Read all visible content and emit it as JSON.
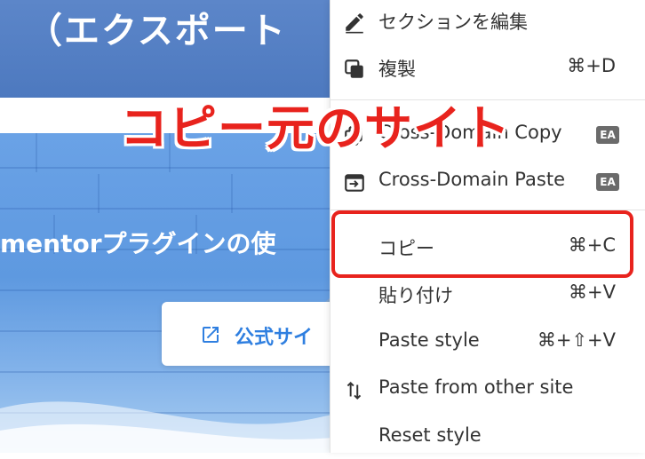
{
  "background_page": {
    "header_title": "（エクスポート",
    "hero_heading": "mentorプラグインの使",
    "official_button_label": "公式サイ"
  },
  "annotation": "コピー元のサイト",
  "context_menu": {
    "items": [
      {
        "label": "セクションを編集",
        "shortcut": "",
        "icon": "pencil-icon",
        "badge": ""
      },
      {
        "label": "複製",
        "shortcut": "⌘+D",
        "icon": "duplicate-icon",
        "badge": ""
      },
      {
        "label": "Cross-Domain Copy",
        "shortcut": "",
        "icon": "copy-icon",
        "badge": "EA"
      },
      {
        "label": "Cross-Domain Paste",
        "shortcut": "",
        "icon": "paste-window-icon",
        "badge": "EA"
      },
      {
        "label": "コピー",
        "shortcut": "⌘+C",
        "icon": "",
        "badge": ""
      },
      {
        "label": "貼り付け",
        "shortcut": "⌘+V",
        "icon": "",
        "badge": ""
      },
      {
        "label": "Paste style",
        "shortcut": "⌘+⇧+V",
        "icon": "",
        "badge": ""
      },
      {
        "label": "Paste from other site",
        "shortcut": "",
        "icon": "swap-arrows-icon",
        "badge": ""
      },
      {
        "label": "Reset style",
        "shortcut": "",
        "icon": "",
        "badge": ""
      }
    ],
    "highlighted_item": "コピー"
  },
  "colors": {
    "annotation_red": "#e8231d",
    "header_blue": "#4d79bf",
    "hero_blue": "#5e99e0",
    "link_blue": "#2f7fe0",
    "badge_gray": "#6b6b6b"
  }
}
